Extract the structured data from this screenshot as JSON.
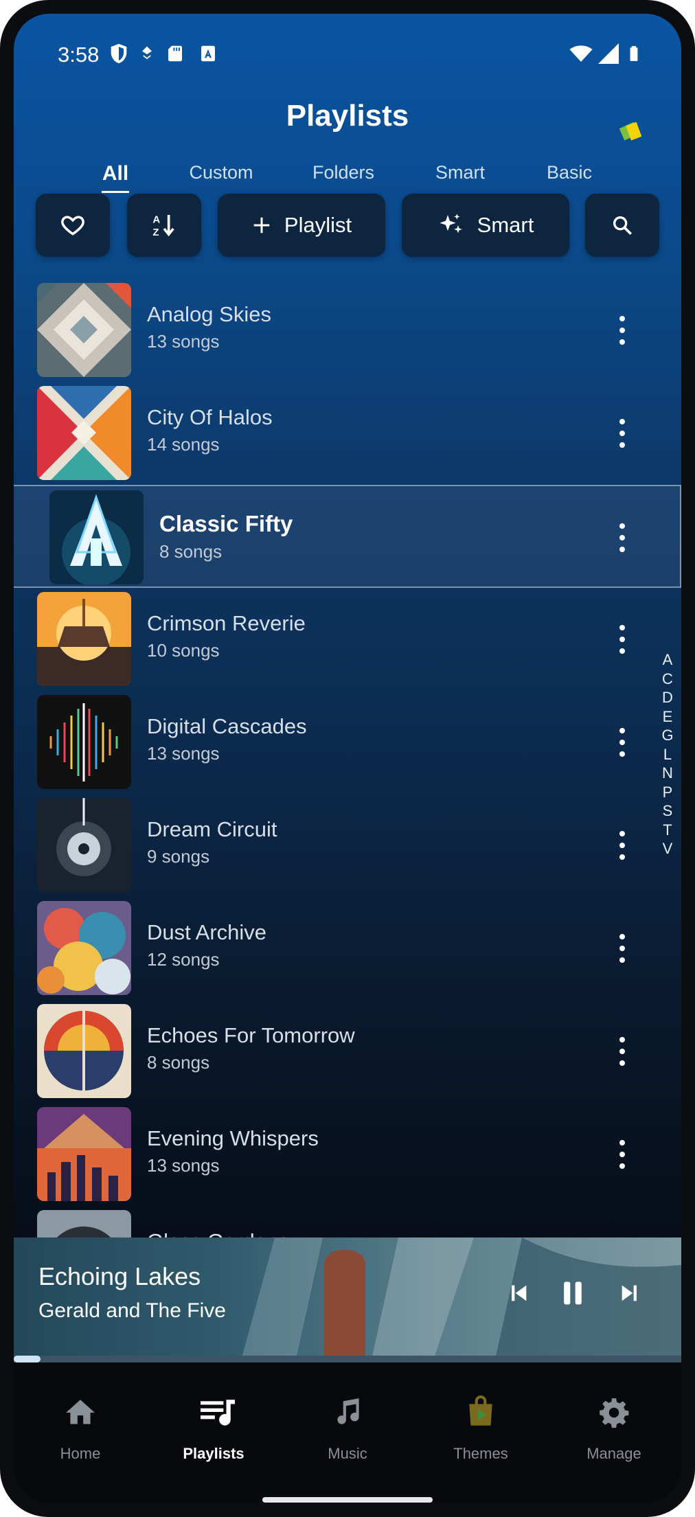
{
  "status_bar": {
    "time": "3:58"
  },
  "header": {
    "title": "Playlists",
    "tabs": [
      {
        "label": "All",
        "active": true
      },
      {
        "label": "Custom",
        "active": false
      },
      {
        "label": "Folders",
        "active": false
      },
      {
        "label": "Smart",
        "active": false
      },
      {
        "label": "Basic",
        "active": false
      }
    ]
  },
  "toolbar": {
    "favorites_icon": "heart-icon",
    "sort_icon": "sort-az-icon",
    "new_playlist_label": "Playlist",
    "smart_label": "Smart",
    "search_icon": "search-icon"
  },
  "playlists": [
    {
      "name": "Analog Skies",
      "count": "13 songs"
    },
    {
      "name": "City Of Halos",
      "count": "14 songs"
    },
    {
      "name": "Classic Fifty",
      "count": "8 songs",
      "selected": true
    },
    {
      "name": "Crimson Reverie",
      "count": "10 songs"
    },
    {
      "name": "Digital Cascades",
      "count": "13 songs"
    },
    {
      "name": "Dream Circuit",
      "count": "9 songs"
    },
    {
      "name": "Dust Archive",
      "count": "12 songs"
    },
    {
      "name": "Echoes For Tomorrow",
      "count": "8 songs"
    },
    {
      "name": "Evening Whispers",
      "count": "13 songs"
    },
    {
      "name": "Glass Gardens",
      "count": ""
    }
  ],
  "alphabet_index": [
    "A",
    "C",
    "D",
    "E",
    "G",
    "L",
    "N",
    "P",
    "S",
    "T",
    "V"
  ],
  "now_playing": {
    "track": "Echoing Lakes",
    "artist": "Gerald and The Five",
    "progress": 0.04
  },
  "bottom_nav": [
    {
      "label": "Home",
      "icon": "home-icon",
      "active": false
    },
    {
      "label": "Playlists",
      "icon": "playlist-icon",
      "active": true
    },
    {
      "label": "Music",
      "icon": "music-note-icon",
      "active": false
    },
    {
      "label": "Themes",
      "icon": "themes-icon",
      "active": false
    },
    {
      "label": "Manage",
      "icon": "gear-icon",
      "active": false
    }
  ],
  "colors": {
    "accent_top": "#0a55a2",
    "background_bottom": "#05090f",
    "selected_border": "#c8d7eb"
  }
}
